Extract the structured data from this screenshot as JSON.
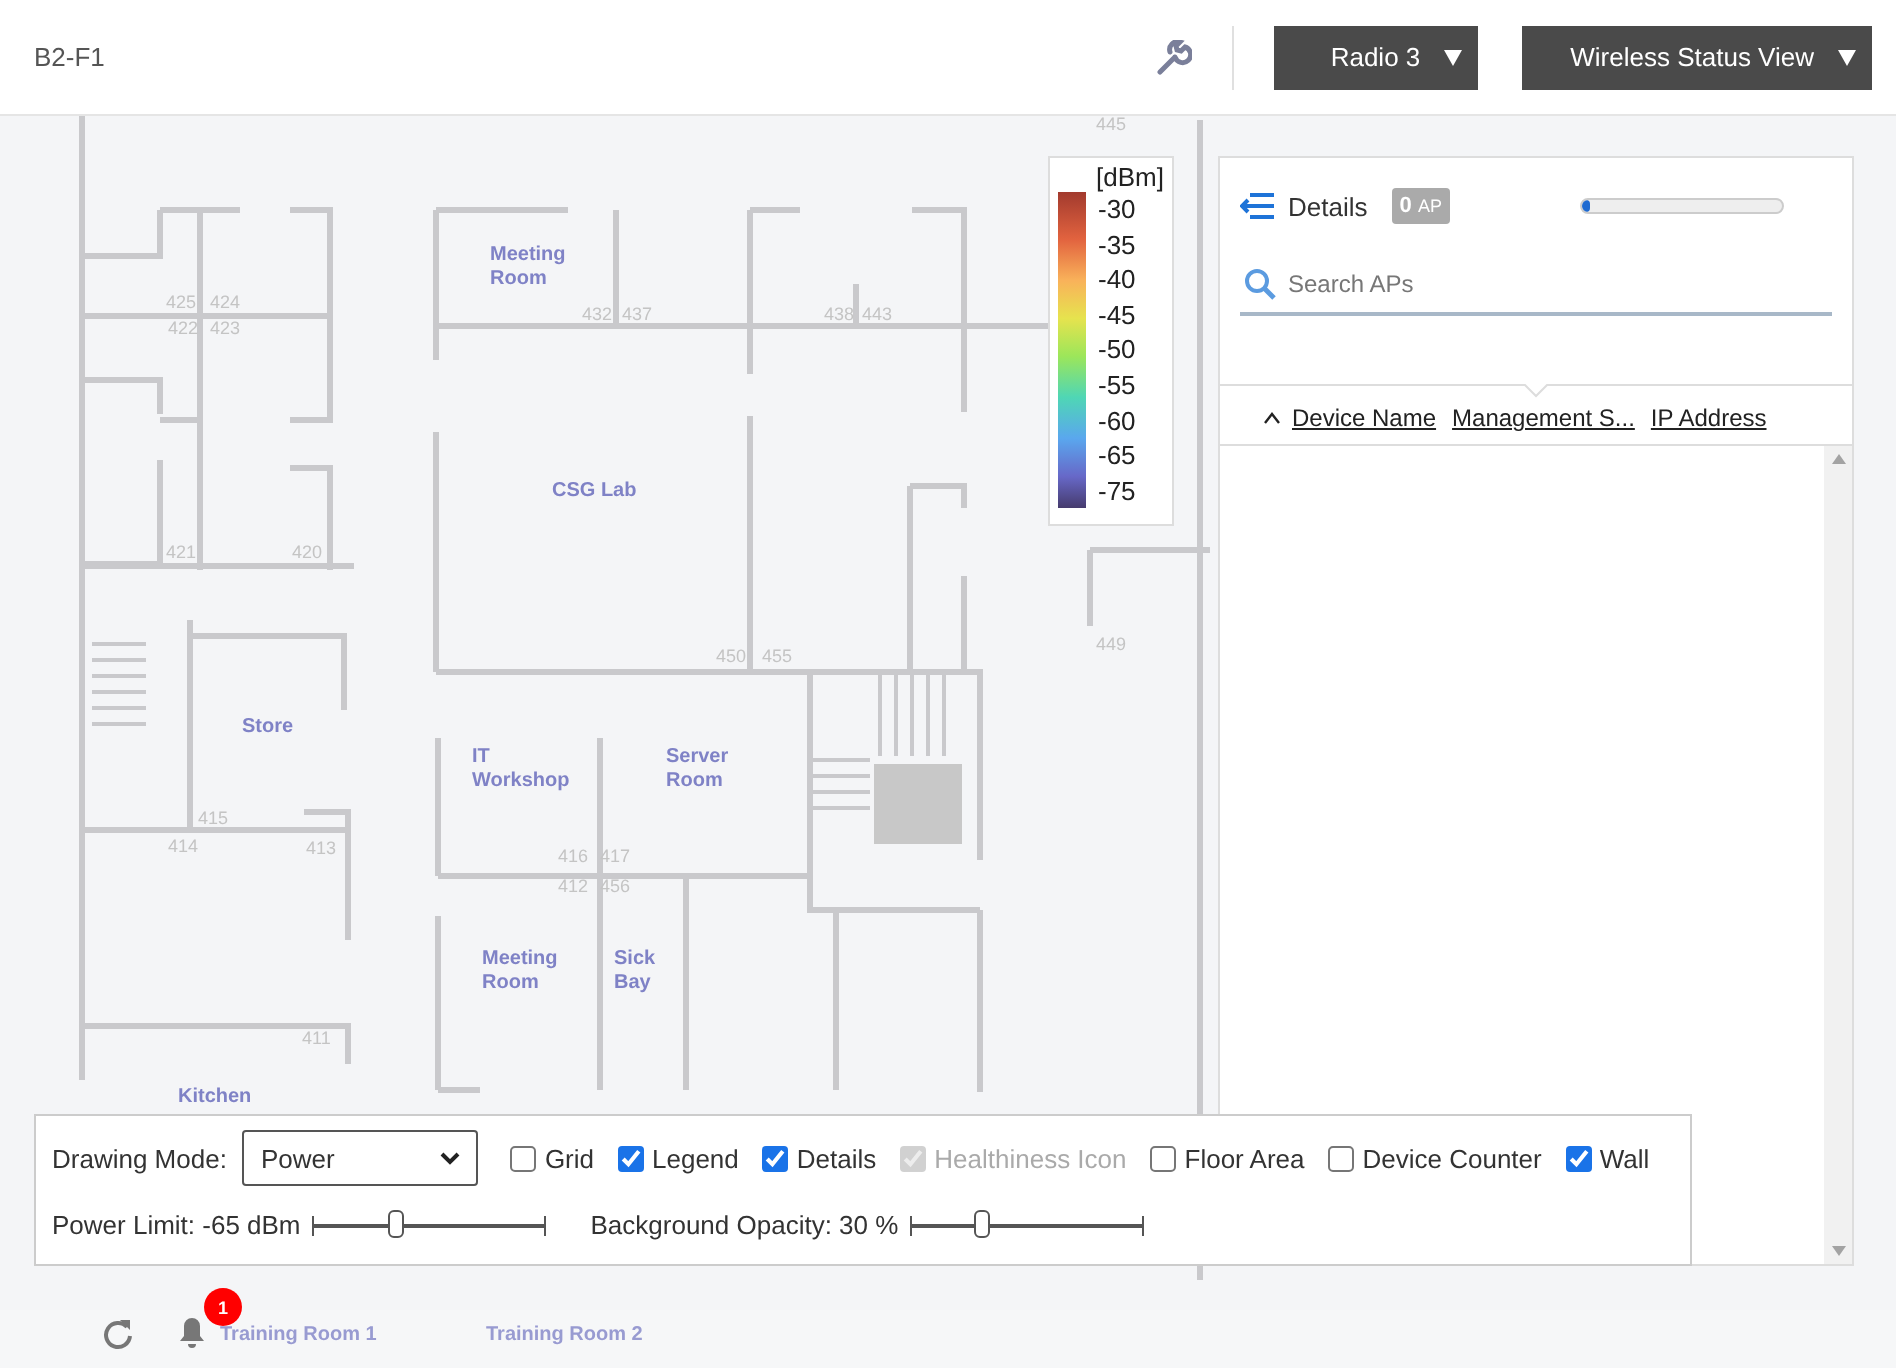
{
  "header": {
    "floor": "B2-F1",
    "radio_button": "Radio 3",
    "view_button": "Wireless Status View"
  },
  "floor_plan": {
    "rooms": [
      "Meeting Room",
      "CSG Lab",
      "Store",
      "IT Workshop",
      "Server Room",
      "Meeting Room",
      "Sick Bay",
      "Kitchen",
      "Training Room 1",
      "Training Room 2"
    ],
    "room_numbers": [
      "425",
      "424",
      "422",
      "423",
      "421",
      "420",
      "432",
      "437",
      "438",
      "443",
      "450",
      "455",
      "415",
      "414",
      "413",
      "416",
      "417",
      "412",
      "456",
      "411",
      "449",
      "445"
    ]
  },
  "legend": {
    "unit": "[dBm]",
    "labels": [
      "-30",
      "-35",
      "-40",
      "-45",
      "-50",
      "-55",
      "-60",
      "-65",
      "-75"
    ]
  },
  "details_panel": {
    "title": "Details",
    "ap_count": "0",
    "ap_unit": "AP",
    "progress": {
      "level": 0.04
    },
    "search": {
      "placeholder": "Search APs"
    },
    "columns": [
      {
        "label": "Device Name",
        "sorted": true
      },
      {
        "label": "Management S...",
        "sorted": false
      },
      {
        "label": "IP Address",
        "sorted": false
      }
    ]
  },
  "controls": {
    "drawing_mode_label": "Drawing Mode:",
    "drawing_mode": "Power",
    "checkboxes": [
      {
        "label": "Grid",
        "checked": false,
        "disabled": false
      },
      {
        "label": "Legend",
        "checked": true,
        "disabled": false
      },
      {
        "label": "Details",
        "checked": true,
        "disabled": false
      },
      {
        "label": "Healthiness Icon",
        "checked": true,
        "disabled": true
      },
      {
        "label": "Floor Area",
        "checked": false,
        "disabled": false
      },
      {
        "label": "Device Counter",
        "checked": false,
        "disabled": false
      },
      {
        "label": "Wall",
        "checked": true,
        "disabled": false
      }
    ],
    "sliders": [
      {
        "label": "Power Limit: -65 dBm",
        "level": 0.36
      },
      {
        "label": "Background Opacity: 30 %",
        "level": 0.31
      }
    ]
  },
  "footer": {
    "notification_count": "1"
  }
}
